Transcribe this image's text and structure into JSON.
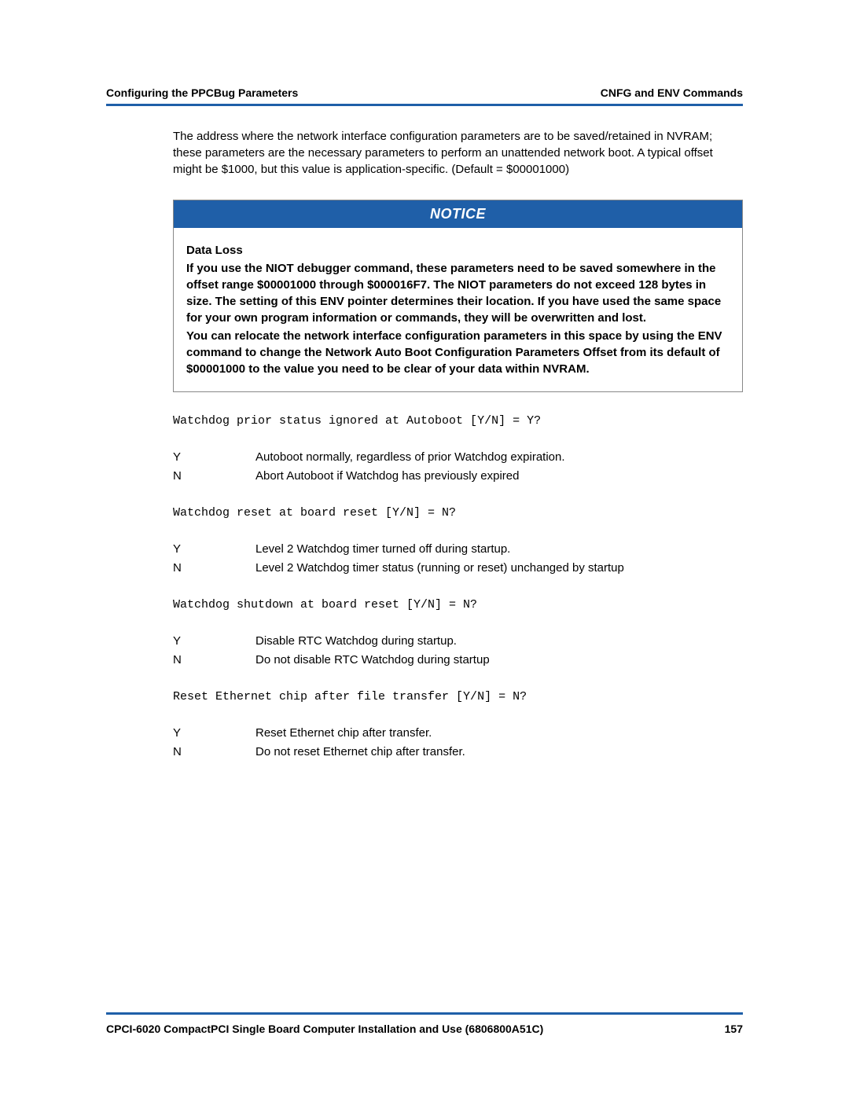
{
  "header": {
    "left": "Configuring the PPCBug Parameters",
    "right": "CNFG and ENV Commands"
  },
  "intro_para": "The address where the network interface configuration parameters are to be saved/retained in NVRAM; these parameters are the necessary parameters to perform an unattended network boot. A typical offset might be $1000, but this value is application-specific. (Default = $00001000)",
  "notice": {
    "label": "NOTICE",
    "title": "Data Loss",
    "p1": "If you use the NIOT debugger command, these parameters need to be saved somewhere in the offset range $00001000 through $000016F7. The NIOT parameters do not exceed 128 bytes in size. The setting of this ENV pointer determines their location. If you have used the same space for your own program information or commands, they will be overwritten and lost.",
    "p2": "You can relocate the network interface configuration parameters in this space by using the ENV command to change the Network Auto Boot Configuration Parameters Offset from its default of $00001000 to the value you need to be clear of your data within NVRAM."
  },
  "prompts": [
    {
      "text": "Watchdog prior status ignored at Autoboot [Y/N] = Y?",
      "options": [
        {
          "k": "Y",
          "v": "Autoboot normally, regardless of prior Watchdog expiration."
        },
        {
          "k": "N",
          "v": "Abort Autoboot if Watchdog has previously expired"
        }
      ]
    },
    {
      "text": "Watchdog reset at board reset [Y/N] = N?",
      "options": [
        {
          "k": "Y",
          "v": "Level 2 Watchdog timer turned off during startup."
        },
        {
          "k": "N",
          "v": "Level 2 Watchdog timer status (running or reset) unchanged by startup"
        }
      ]
    },
    {
      "text": "Watchdog shutdown at board reset [Y/N] = N?",
      "options": [
        {
          "k": "Y",
          "v": "Disable RTC Watchdog during startup."
        },
        {
          "k": "N",
          "v": "Do not disable RTC Watchdog during startup"
        }
      ]
    },
    {
      "text": "Reset Ethernet chip after file transfer [Y/N] = N?",
      "options": [
        {
          "k": "Y",
          "v": "Reset Ethernet chip after transfer."
        },
        {
          "k": "N",
          "v": "Do not reset Ethernet chip after transfer."
        }
      ]
    }
  ],
  "footer": {
    "left": "CPCI-6020 CompactPCI Single Board Computer Installation and Use (6806800A51C)",
    "page": "157"
  }
}
